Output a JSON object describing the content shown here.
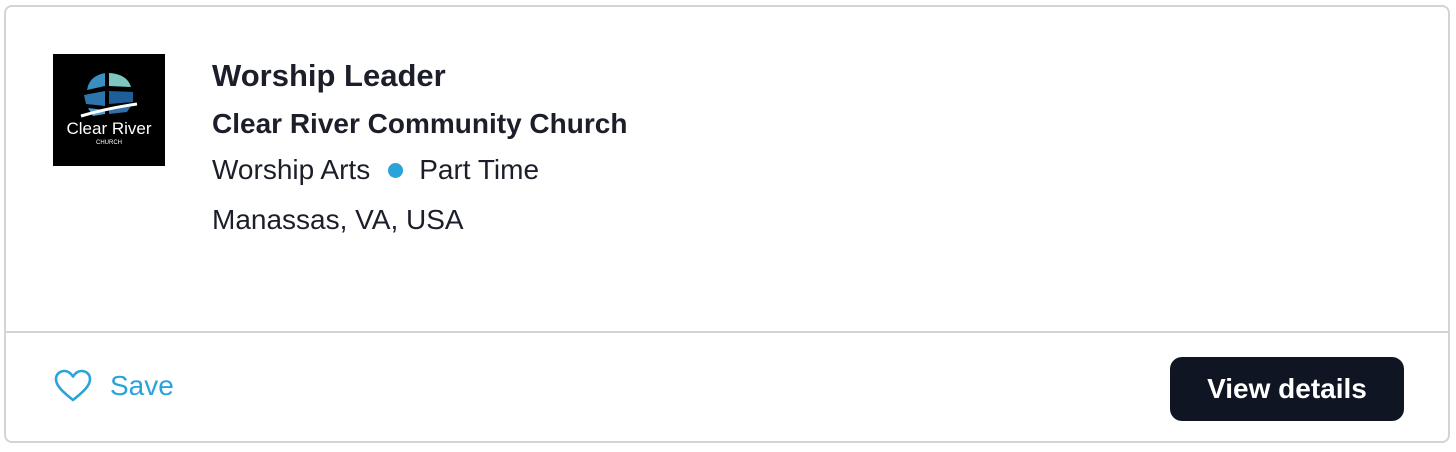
{
  "job": {
    "title": "Worship Leader",
    "organization": "Clear River Community Church",
    "department": "Worship Arts",
    "employment_type": "Part Time",
    "location": "Manassas, VA, USA"
  },
  "logo": {
    "text_main": "Clear River",
    "text_sub": "CHURCH"
  },
  "actions": {
    "save_label": "Save",
    "view_details_label": "View details"
  },
  "colors": {
    "accent": "#2aa3db",
    "button_bg": "#0f1523",
    "text": "#1c1f2a",
    "border": "#d4d4d4"
  },
  "icons": {
    "save": "heart-outline-icon",
    "separator": "dot-icon"
  }
}
